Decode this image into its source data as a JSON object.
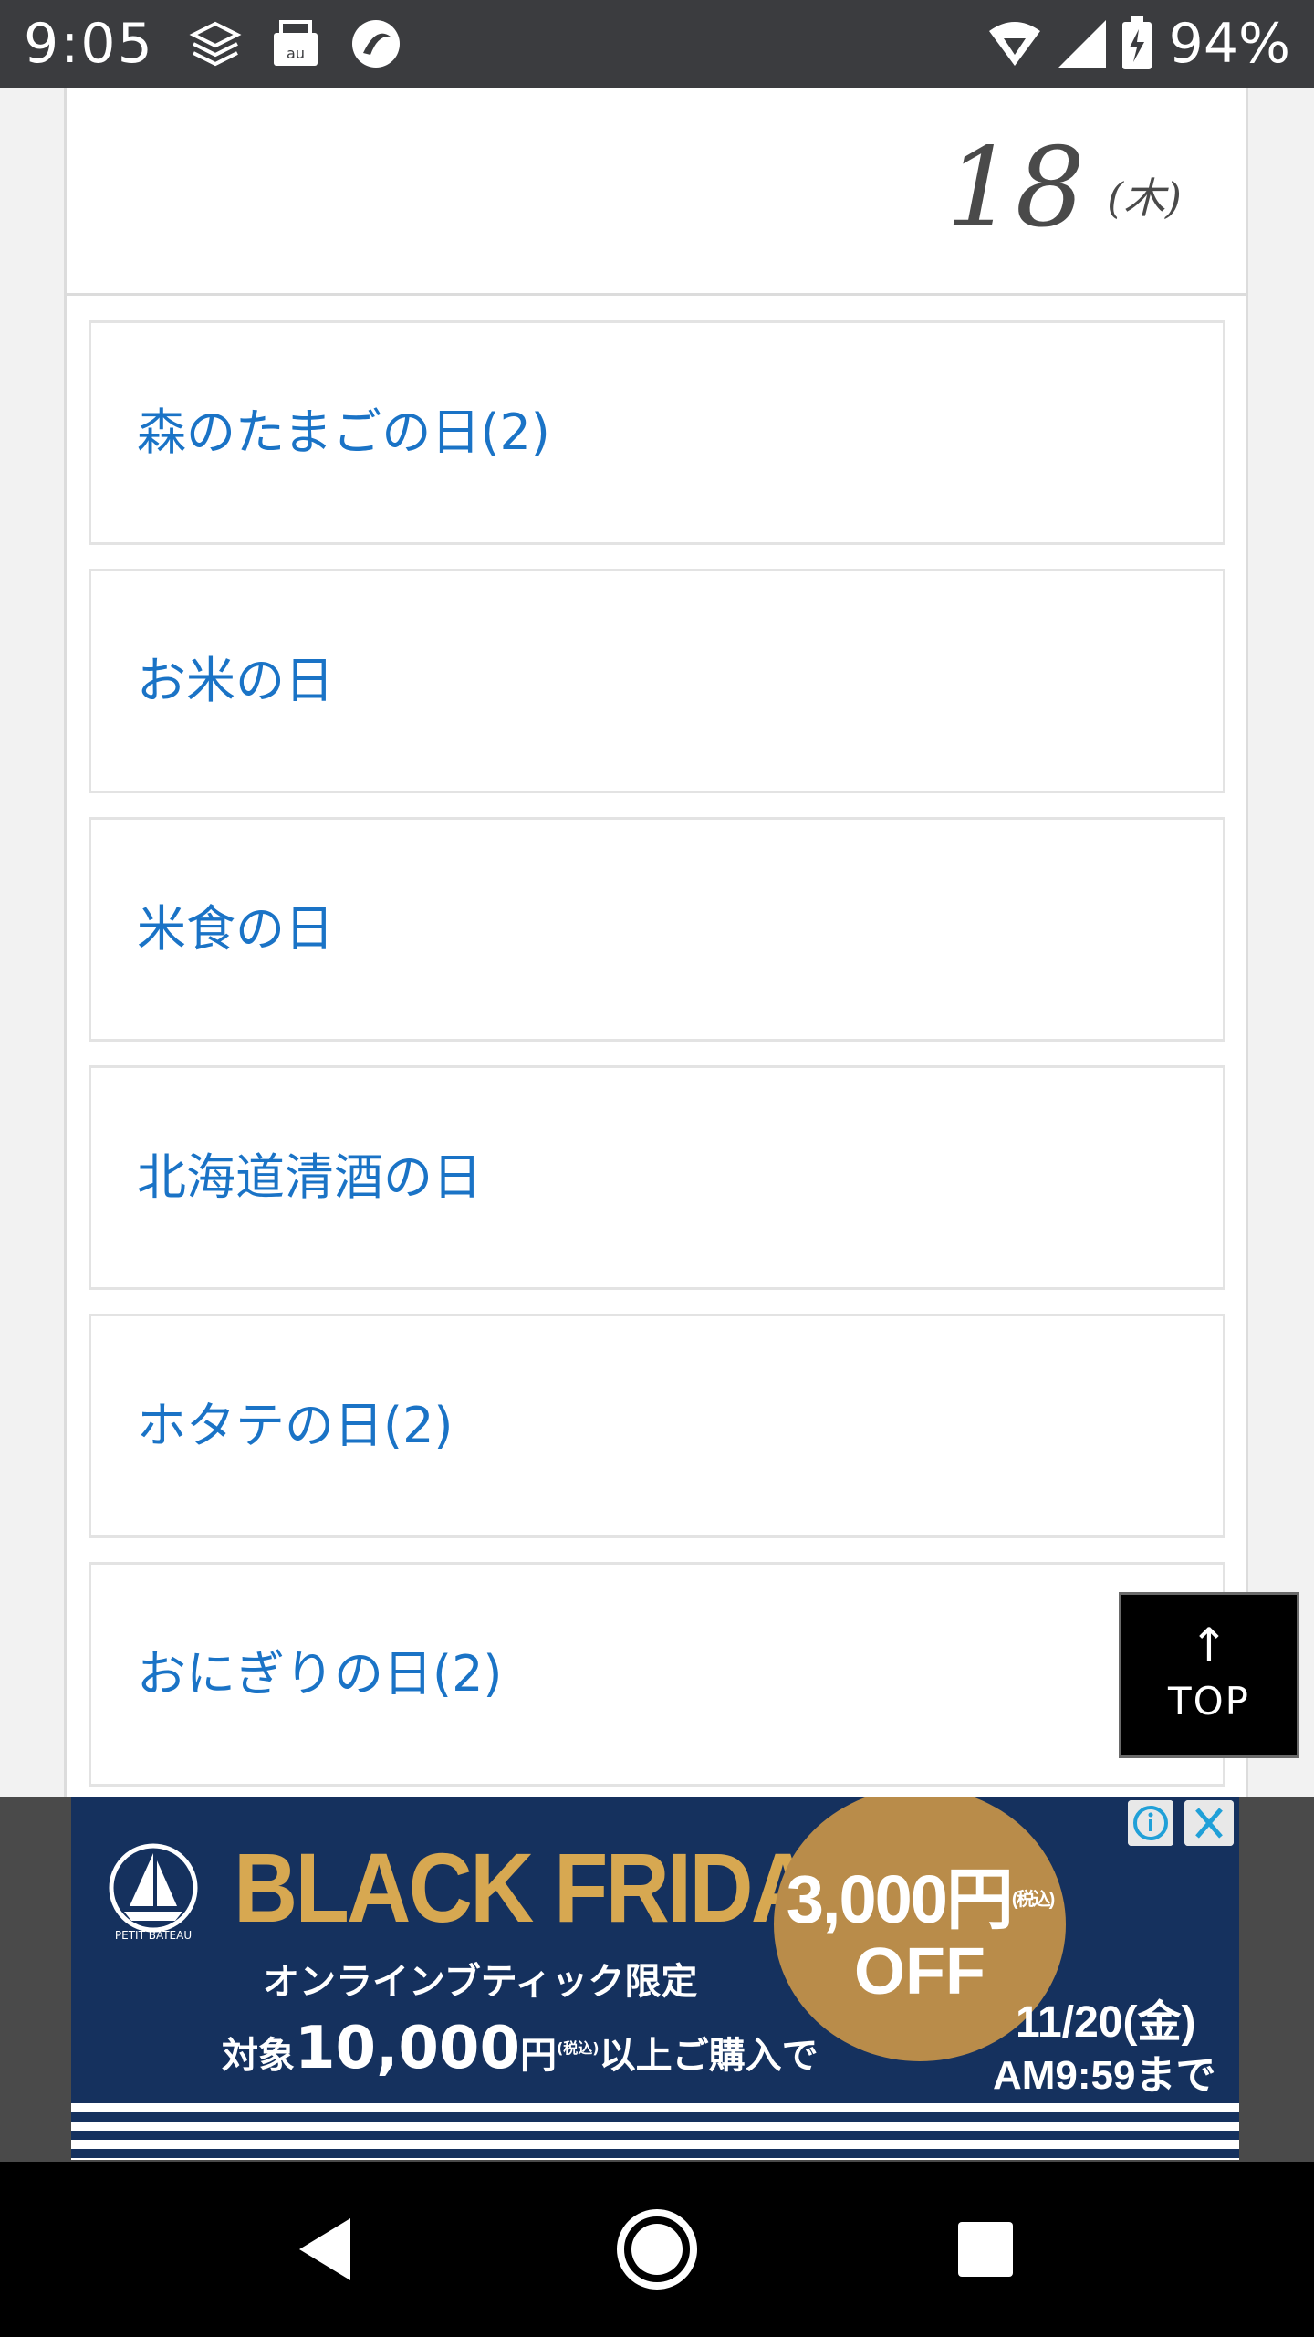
{
  "status_bar": {
    "time": "9:05",
    "battery": "94%",
    "icons": [
      "layers-icon",
      "au-mail-icon",
      "circle-app-icon",
      "wifi-icon",
      "signal-icon",
      "battery-charging-icon"
    ]
  },
  "date": {
    "day": "18",
    "weekday": "(木)"
  },
  "events": [
    {
      "label": "森のたまごの日(2)"
    },
    {
      "label": "お米の日"
    },
    {
      "label": "米食の日"
    },
    {
      "label": "北海道清酒の日"
    },
    {
      "label": "ホタテの日(2)"
    },
    {
      "label": "おにぎりの日(2)"
    }
  ],
  "top_button": {
    "arrow": "↑",
    "label": "TOP"
  },
  "ad": {
    "brand": "PETIT BATEAU",
    "title": "BLACK FRIDAY",
    "price": "3,000円",
    "price_note": "(税込)",
    "off": "OFF",
    "line1": "オンラインブティック限定",
    "line2_prefix": "対象",
    "line2_amount": "10,000",
    "line2_suffix": "円",
    "line2_note": "(税込)",
    "line2_rest": "以上ご購入で",
    "date_line1": "11/20(金)",
    "date_line2": "AM9:59まで",
    "info_icon": "info-icon",
    "close_icon": "close-icon",
    "colors": {
      "background": "#15315e",
      "gold": "#d7a851",
      "blob": "#b98c4a"
    }
  },
  "nav": {
    "back": "back-icon",
    "home": "home-icon",
    "recents": "recents-icon"
  }
}
